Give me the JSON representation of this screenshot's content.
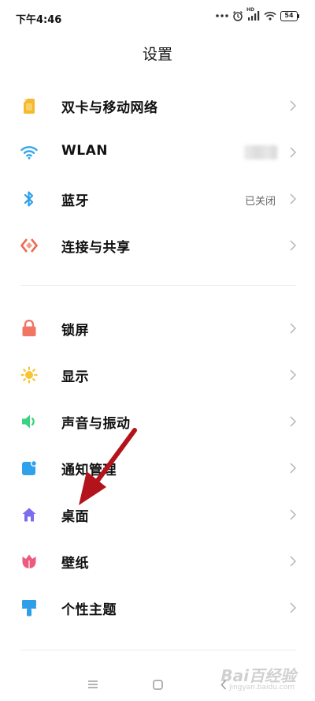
{
  "status_bar": {
    "time": "下午4:46",
    "hd_label": "HD",
    "battery": "54"
  },
  "header": {
    "title": "设置"
  },
  "groups": [
    {
      "items": [
        {
          "id": "sim",
          "label": "双卡与移动网络",
          "icon": "sim-card-icon",
          "color": "#f5b82e"
        },
        {
          "id": "wlan",
          "label": "WLAN",
          "icon": "wifi-icon",
          "color": "#31a8e8"
        },
        {
          "id": "bluetooth",
          "label": "蓝牙",
          "value": "已关闭",
          "icon": "bluetooth-icon",
          "color": "#2f9ee8"
        },
        {
          "id": "share",
          "label": "连接与共享",
          "icon": "connection-share-icon",
          "color": "#ee6b55"
        }
      ]
    },
    {
      "items": [
        {
          "id": "lock",
          "label": "锁屏",
          "icon": "lock-icon",
          "color": "#f27563"
        },
        {
          "id": "display",
          "label": "显示",
          "icon": "sun-icon",
          "color": "#f7c531"
        },
        {
          "id": "sound",
          "label": "声音与振动",
          "icon": "speaker-icon",
          "color": "#39d27f"
        },
        {
          "id": "notify",
          "label": "通知管理",
          "icon": "notification-icon",
          "color": "#2fa2ec"
        },
        {
          "id": "home",
          "label": "桌面",
          "icon": "home-icon",
          "color": "#7b6cf0"
        },
        {
          "id": "wallpaper",
          "label": "壁纸",
          "icon": "flower-icon",
          "color": "#ee5a7e"
        },
        {
          "id": "theme",
          "label": "个性主题",
          "icon": "paint-brush-icon",
          "color": "#2f9ee8"
        }
      ]
    }
  ],
  "annotation": {
    "arrow_color": "#b3141b"
  },
  "watermark": {
    "text": "Bai百经验",
    "sub": "jingyan.baidu.com"
  }
}
